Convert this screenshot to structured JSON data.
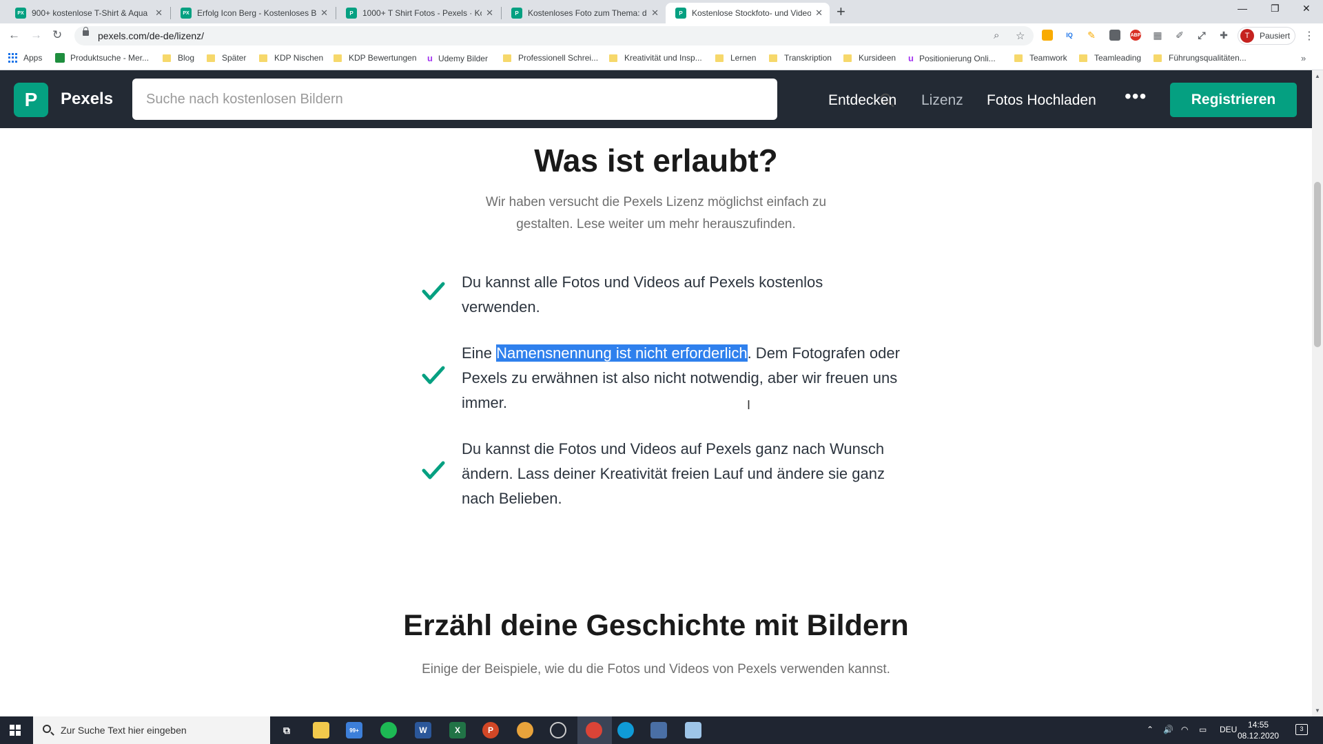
{
  "browser": {
    "tabs": [
      {
        "title": "900+ kostenlose T-Shirt & Aqua",
        "favicon": "PX"
      },
      {
        "title": "Erfolg Icon Berg - Kostenloses Bi",
        "favicon": "PX"
      },
      {
        "title": "1000+ T Shirt Fotos - Pexels · Kos",
        "favicon": "P"
      },
      {
        "title": "Kostenloses Foto zum Thema: dr",
        "favicon": "P"
      },
      {
        "title": "Kostenlose Stockfoto- und Video",
        "favicon": "P"
      }
    ],
    "url": "pexels.com/de-de/lizenz/",
    "profile_label": "Pausiert",
    "profile_initial": "T",
    "bookmarks": [
      "Apps",
      "Produktsuche - Mer...",
      "Blog",
      "Später",
      "KDP Nischen",
      "KDP Bewertungen",
      "Udemy Bilder",
      "Professionell Schrei...",
      "Kreativität und Insp...",
      "Lernen",
      "Transkription",
      "Kursideen",
      "Positionierung Onli...",
      "Teamwork",
      "Teamleading",
      "Führungsqualitäten..."
    ],
    "extensions": [
      "IQ",
      "ABP"
    ]
  },
  "header": {
    "logo_letter": "P",
    "brand": "Pexels",
    "search_placeholder": "Suche nach kostenlosen Bildern",
    "nav": [
      "Entdecken",
      "Lizenz",
      "Fotos Hochladen"
    ],
    "more": "•••",
    "register": "Registrieren"
  },
  "section1": {
    "title": "Was ist erlaubt?",
    "lead_line1": "Wir haben versucht die Pexels Lizenz möglichst einfach zu",
    "lead_line2": "gestalten. Lese weiter um mehr herauszufinden.",
    "item1": "Du kannst alle Fotos und Videos auf Pexels kostenlos verwenden.",
    "item2_before": "Eine ",
    "item2_highlight": "Namensnennung ist nicht erforderlich",
    "item2_after": ". Dem Fotografen oder Pexels zu erwähnen ist also nicht notwendig, aber wir freuen uns immer.",
    "item3": "Du kannst die Fotos und Videos auf Pexels ganz nach Wunsch ändern. Lass deiner Kreativität freien Lauf und ändere sie ganz nach Belieben."
  },
  "section2": {
    "title": "Erzähl deine Geschichte mit Bildern",
    "lead": "Einige der Beispiele, wie du die Fotos und Videos von Pexels verwenden kannst."
  },
  "taskbar": {
    "search_placeholder": "Zur Suche Text hier eingeben",
    "mail_badge": "99+",
    "lang": "DEU",
    "time": "14:55",
    "date": "08.12.2020",
    "notif_count": "3"
  },
  "colors": {
    "pexels_green": "#05a081",
    "header_bg": "#232a34",
    "highlight": "#2f80ed"
  }
}
